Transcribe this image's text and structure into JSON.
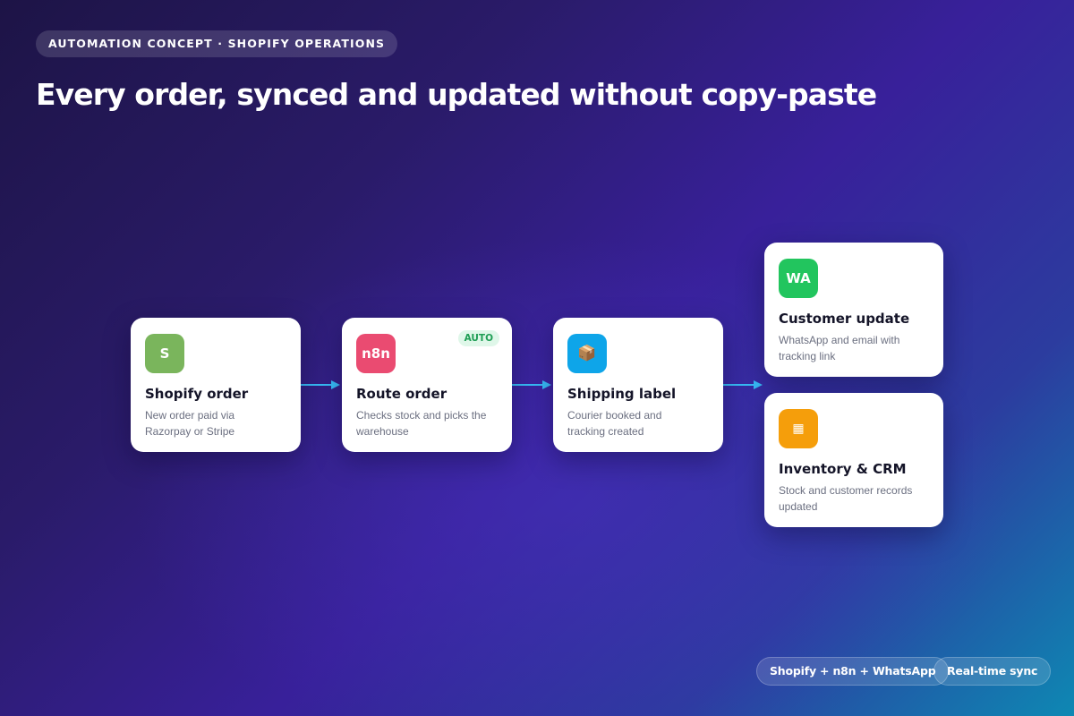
{
  "header": {
    "eyebrow": "AUTOMATION CONCEPT · SHOPIFY OPERATIONS",
    "title": "Every order, synced and updated without copy-paste"
  },
  "flow": {
    "steps": [
      {
        "icon_label": "S",
        "icon_name": "shopify-icon",
        "icon_color": "#7ab55c",
        "title": "Shopify order",
        "description": "New order paid via Razorpay or Stripe"
      },
      {
        "icon_label": "n8n",
        "icon_name": "n8n-icon",
        "icon_color": "#ea4b71",
        "title": "Route order",
        "description": "Checks stock and picks the warehouse",
        "badge": "AUTO",
        "badge_color": "#1f9e55"
      },
      {
        "icon_label": "📦",
        "icon_name": "package-icon",
        "icon_color": "#0ea5e9",
        "title": "Shipping label",
        "description": "Courier booked and tracking created"
      }
    ],
    "outputs": [
      {
        "icon_label": "WA",
        "icon_name": "whatsapp-icon",
        "icon_color": "#22c55e",
        "title": "Customer update",
        "description": "WhatsApp and email with tracking link"
      },
      {
        "icon_label": "▦",
        "icon_name": "database-icon",
        "icon_color": "#f59e0b",
        "title": "Inventory & CRM",
        "description": "Stock and customer records updated"
      }
    ],
    "connector_color": "#38bdf8"
  },
  "footer": {
    "tags": [
      "Shopify + n8n + WhatsApp",
      "Real-time sync"
    ]
  }
}
